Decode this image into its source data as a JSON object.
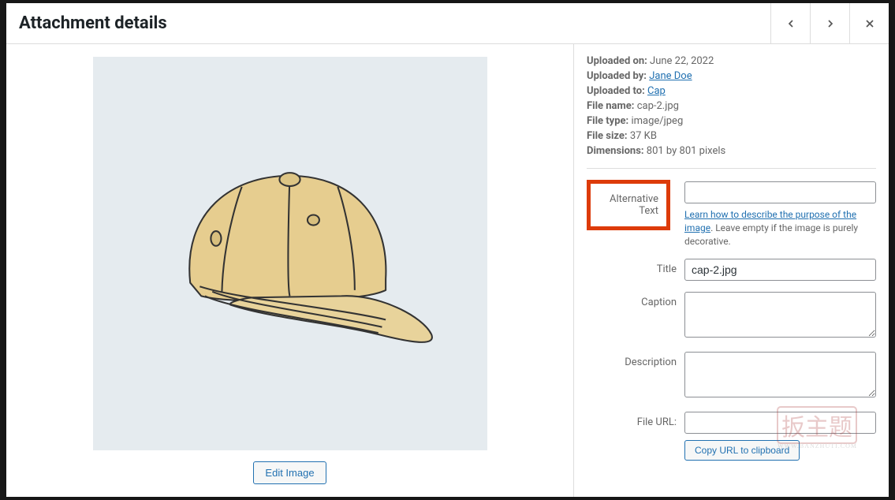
{
  "header": {
    "title": "Attachment details"
  },
  "meta": {
    "uploaded_on_label": "Uploaded on:",
    "uploaded_on": "June 22, 2022",
    "uploaded_by_label": "Uploaded by:",
    "uploaded_by": "Jane Doe",
    "uploaded_to_label": "Uploaded to:",
    "uploaded_to": "Cap",
    "file_name_label": "File name:",
    "file_name": "cap-2.jpg",
    "file_type_label": "File type:",
    "file_type": "image/jpeg",
    "file_size_label": "File size:",
    "file_size": "37 KB",
    "dimensions_label": "Dimensions:",
    "dimensions": "801 by 801 pixels"
  },
  "fields": {
    "alt_text_label": "Alternative Text",
    "alt_text_value": "",
    "alt_help_link": "Learn how to describe the purpose of the image",
    "alt_help_suffix": ". Leave empty if the image is purely decorative.",
    "title_label": "Title",
    "title_value": "cap-2.jpg",
    "caption_label": "Caption",
    "caption_value": "",
    "description_label": "Description",
    "description_value": "",
    "file_url_label": "File URL:",
    "file_url_value": "",
    "copy_btn": "Copy URL to clipboard"
  },
  "edit_image_label": "Edit Image",
  "watermark": {
    "brand": "扳主题",
    "url": "WWW.BANZHUTI.COM"
  }
}
